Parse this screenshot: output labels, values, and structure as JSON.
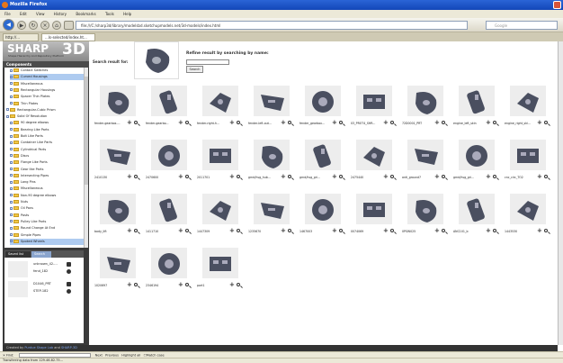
{
  "window": {
    "title": "Mozilla Firefox"
  },
  "menu": [
    "File",
    "Edit",
    "View",
    "History",
    "Bookmarks",
    "Tools",
    "Help"
  ],
  "nav": {
    "url": "file:///C:/sharp3d/library/modelsbd.sketchupmodels.net/3d-models/index.html",
    "search_placeholder": "Google"
  },
  "tabs": [
    {
      "label": "http://..."
    },
    {
      "label": "...ls-selected/index.ht..."
    }
  ],
  "logo": {
    "main": "SHARP",
    "accent": "3D",
    "tagline": "Shape Hierarchy And Repository Platform"
  },
  "sidebar": {
    "header": "Components",
    "tree": [
      {
        "label": "Contact Switches",
        "sel": false
      },
      {
        "label": "Curved Housings",
        "sel": true
      },
      {
        "label": "Miscellaneous",
        "sel": false
      },
      {
        "label": "Rectangular Housings",
        "sel": false
      },
      {
        "label": "Spacer Thin Plates",
        "sel": false
      },
      {
        "label": "Thin Plates",
        "sel": false
      },
      {
        "label": "Rectangular-Cubic Prism",
        "sel": false
      },
      {
        "label": "Solid Of Revolution",
        "sel": false
      },
      {
        "label": "90 degree elbows",
        "sel": false
      },
      {
        "label": "Bearing Like Parts",
        "sel": false
      },
      {
        "label": "Bolt Like Parts",
        "sel": false
      },
      {
        "label": "Container Like Parts",
        "sel": false
      },
      {
        "label": "Cylindrical Parts",
        "sel": false
      },
      {
        "label": "Discs",
        "sel": false
      },
      {
        "label": "Flange Like Parts",
        "sel": false
      },
      {
        "label": "Gear like Parts",
        "sel": false
      },
      {
        "label": "Intersecting Pipes",
        "sel": false
      },
      {
        "label": "Long Pins",
        "sel": false
      },
      {
        "label": "Miscellaneous",
        "sel": false
      },
      {
        "label": "Non-90 degree elbows",
        "sel": false
      },
      {
        "label": "Nuts",
        "sel": false
      },
      {
        "label": "Oil Pans",
        "sel": false
      },
      {
        "label": "Posts",
        "sel": false
      },
      {
        "label": "Pulley Like Parts",
        "sel": false
      },
      {
        "label": "Round Change At End",
        "sel": false
      },
      {
        "label": "Simple Pipes",
        "sel": false
      },
      {
        "label": "Spoked Wheels",
        "sel": true
      }
    ],
    "tab_recent": "Saved list",
    "tab_search": "Search",
    "recent": [
      {
        "name": "unknown_42-...",
        "id": "fend_182"
      },
      {
        "name": "D1046_PRT",
        "id": "STEP-182"
      }
    ]
  },
  "search": {
    "result_label": "Search result for:",
    "refine_label": "Refine result by searching by name:",
    "refine_value": "",
    "button": "Search"
  },
  "results": [
    {
      "name": "fender-gearbox-..."
    },
    {
      "name": "fender-gearbo..."
    },
    {
      "name": "fender-right-h..."
    },
    {
      "name": "fender-left-out..."
    },
    {
      "name": "fender_gearbox..."
    },
    {
      "name": "03_PROT4_SHR..."
    },
    {
      "name": "72D0001_PRT"
    },
    {
      "name": "engine_left_skin"
    },
    {
      "name": "engine_right_ski..."
    },
    {
      "name": "2410130"
    },
    {
      "name": "2470600"
    },
    {
      "name": "2011701"
    },
    {
      "name": "grnd/hsg_hub..."
    },
    {
      "name": "grnd/hsg_gri..."
    },
    {
      "name": "2475440"
    },
    {
      "name": "anti_ground7"
    },
    {
      "name": "grnd/hsg_gri..."
    },
    {
      "name": "cnc_circ_TO2"
    },
    {
      "name": "body_lift"
    },
    {
      "name": "1411710"
    },
    {
      "name": "1447309"
    },
    {
      "name": "1235670"
    },
    {
      "name": "1467003"
    },
    {
      "name": "0074069"
    },
    {
      "name": "0PSW025"
    },
    {
      "name": "ANC101_b"
    },
    {
      "name": "1443530"
    },
    {
      "name": "1020697"
    },
    {
      "name": "2346194"
    },
    {
      "name": "part1"
    }
  ],
  "footer": {
    "text": "Created by ",
    "link1": "Purdue Shape Lab",
    "mid": " and ",
    "link2": "SHARP-3D"
  },
  "findbar": {
    "label": "Find:",
    "next": "Next",
    "prev": "Previous",
    "highlight": "Highlight all",
    "match": "Match case"
  },
  "status": "Transferring data from 129.46.82.75..."
}
